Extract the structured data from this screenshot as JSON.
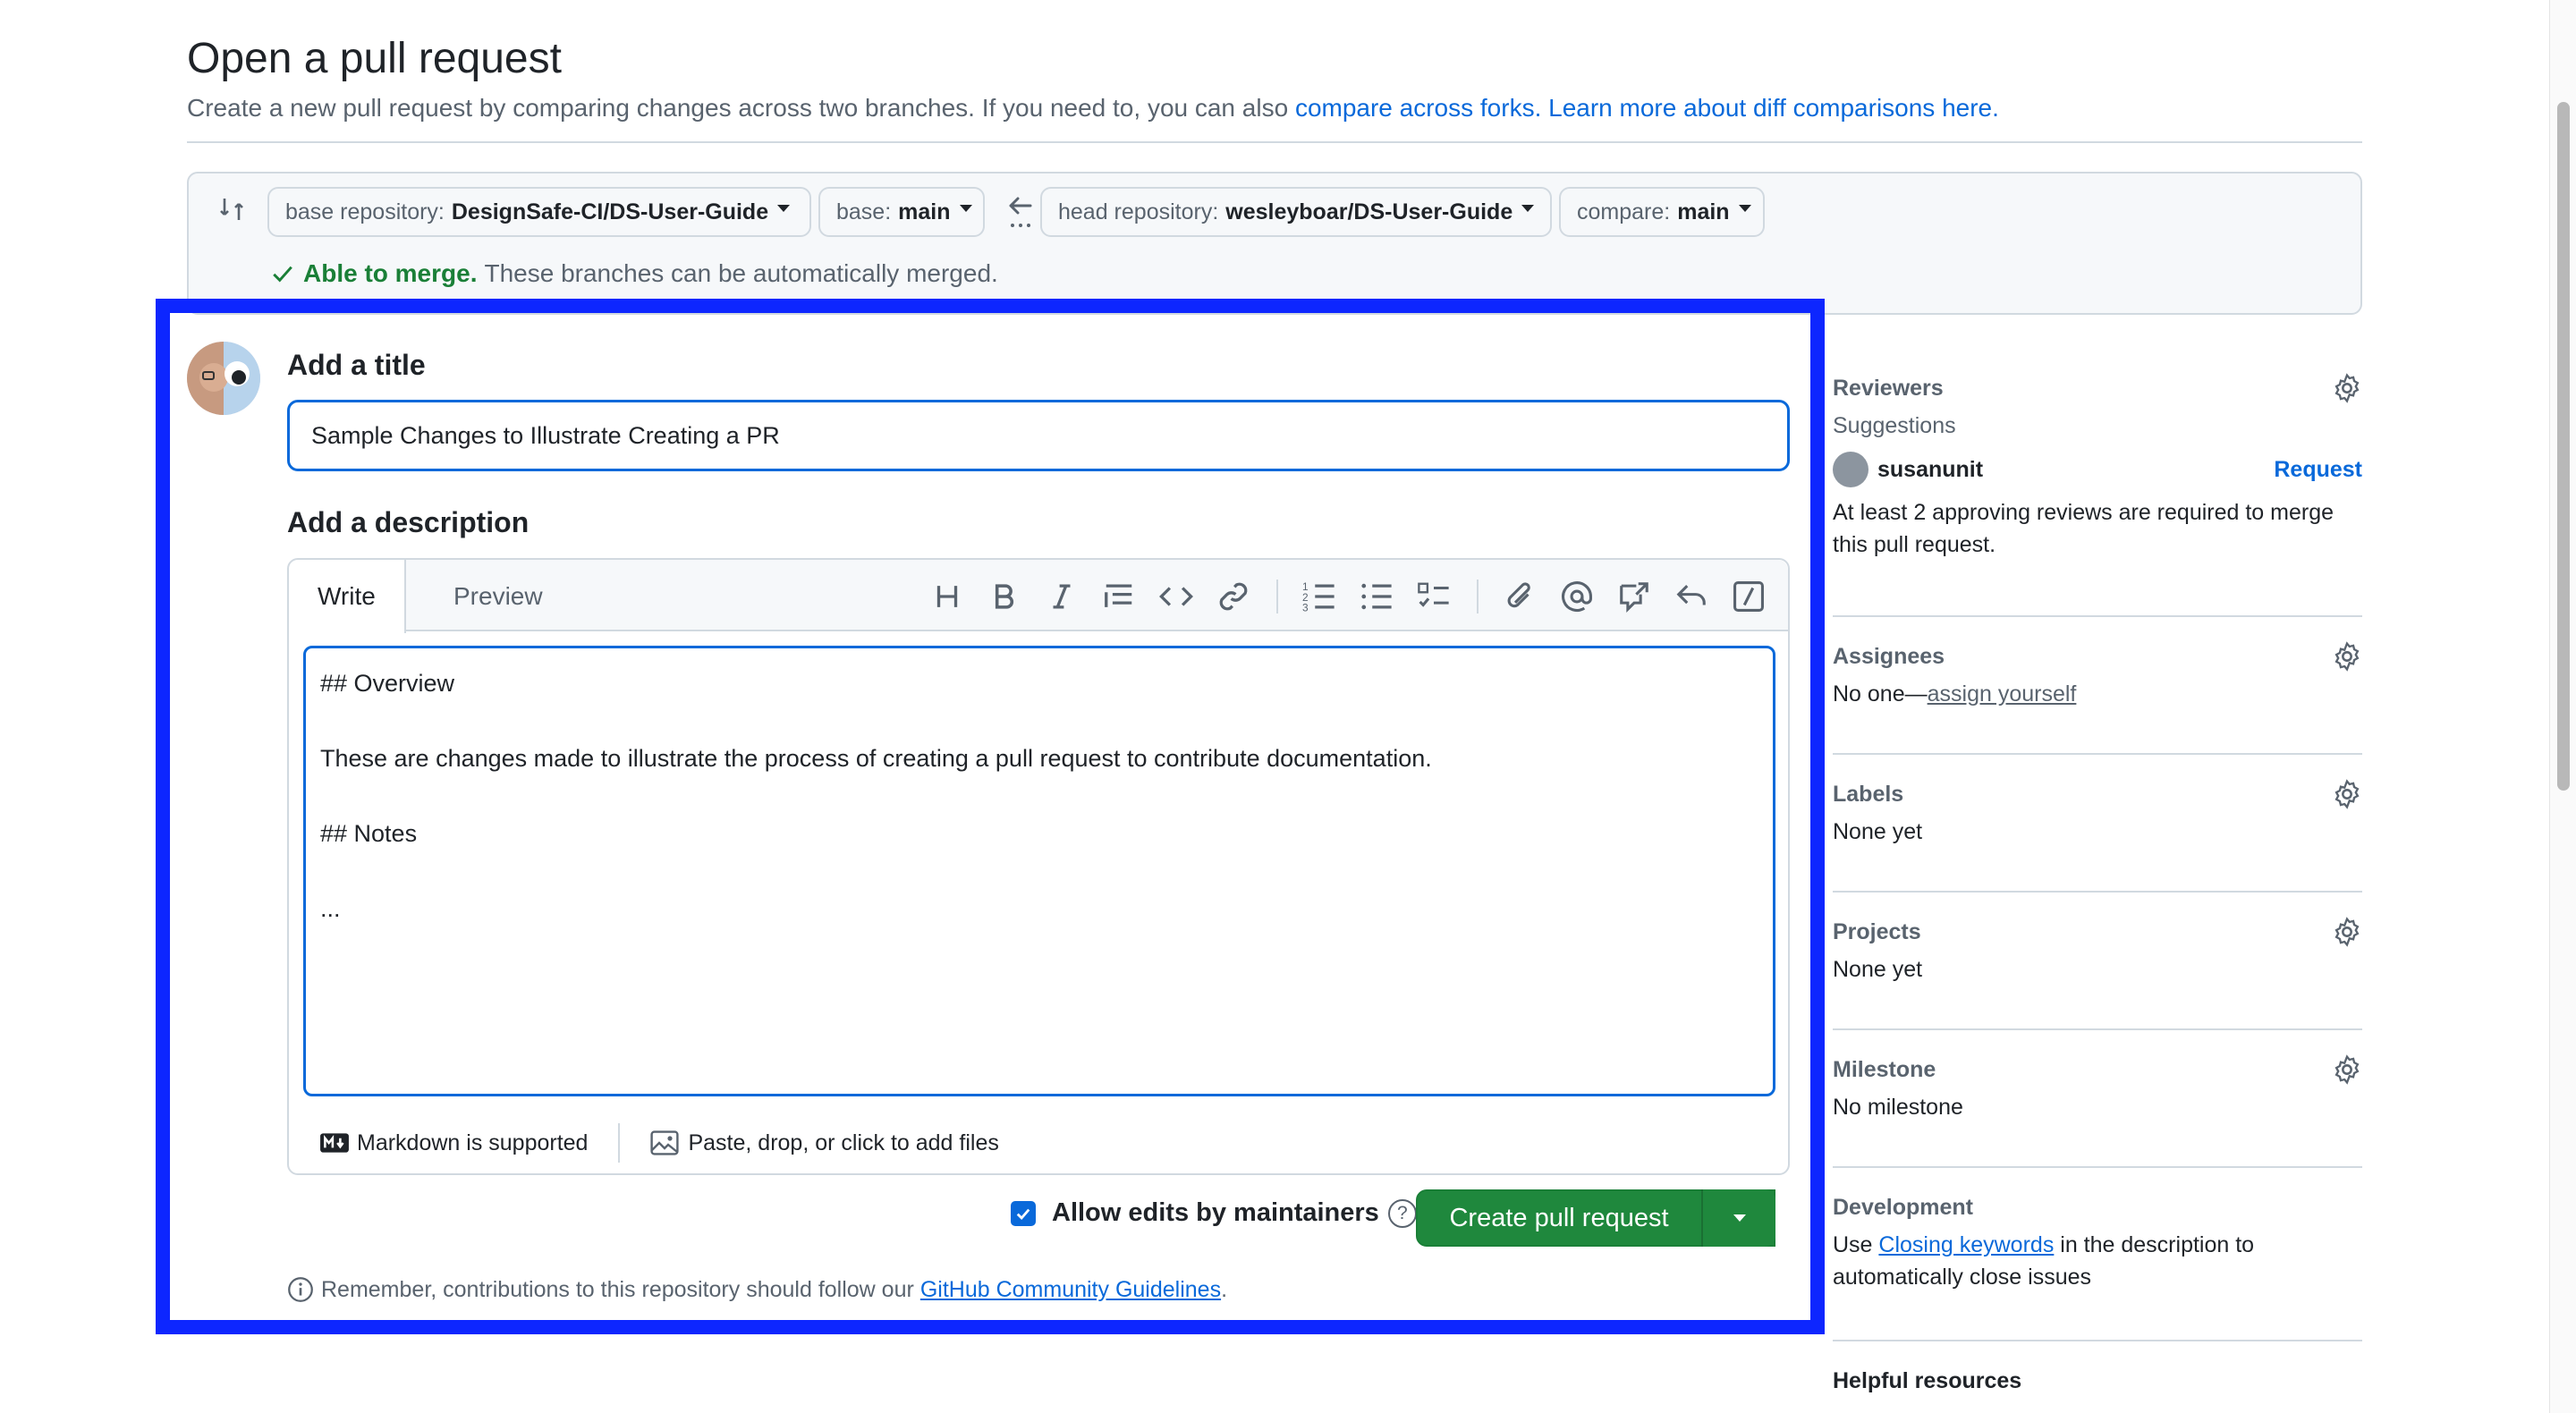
{
  "page": {
    "title": "Open a pull request",
    "subtitle": "Create a new pull request by comparing changes across two branches. If you need to, you can also ",
    "link_forks": "compare across forks.",
    "link_learn": "Learn more about diff comparisons here."
  },
  "compare": {
    "base_repo_label": "base repository:",
    "base_repo_value": "DesignSafe-CI/DS-User-Guide",
    "base_label": "base:",
    "base_value": "main",
    "head_repo_label": "head repository:",
    "head_repo_value": "wesleyboar/DS-User-Guide",
    "compare_label": "compare:",
    "compare_value": "main",
    "merge_ok": "Able to merge.",
    "merge_text": "These branches can be automatically merged."
  },
  "form": {
    "title_heading": "Add a title",
    "title_value": "Sample Changes to Illustrate Creating a PR",
    "desc_heading": "Add a description",
    "tab_write": "Write",
    "tab_preview": "Preview",
    "desc_value": "## Overview\n\nThese are changes made to illustrate the process of creating a pull request to contribute documentation.\n\n## Notes\n\n...",
    "markdown_note": "Markdown is supported",
    "attach_note": "Paste, drop, or click to add files",
    "allow_edits": "Allow edits by maintainers",
    "create_button": "Create pull request",
    "remember_text": "Remember, contributions to this repository should follow our",
    "guidelines_link": "GitHub Community Guidelines",
    "remember_end": "."
  },
  "sidebar": {
    "reviewers": "Reviewers",
    "suggestions": "Suggestions",
    "suggested_user": "susanunit",
    "request": "Request",
    "reviewers_note": "At least 2 approving reviews are required to merge this pull request.",
    "assignees": "Assignees",
    "assignees_prefix": "No one—",
    "assign_yourself": "assign yourself",
    "labels": "Labels",
    "labels_value": "None yet",
    "projects": "Projects",
    "projects_value": "None yet",
    "milestone": "Milestone",
    "milestone_value": "No milestone",
    "development": "Development",
    "dev_prefix": "Use ",
    "dev_link": "Closing keywords",
    "dev_suffix": " in the description to automatically close issues",
    "helpful": "Helpful resources"
  },
  "colors": {
    "accent": "#0969da",
    "success": "#1f883d",
    "highlight": "#0d26ff"
  }
}
